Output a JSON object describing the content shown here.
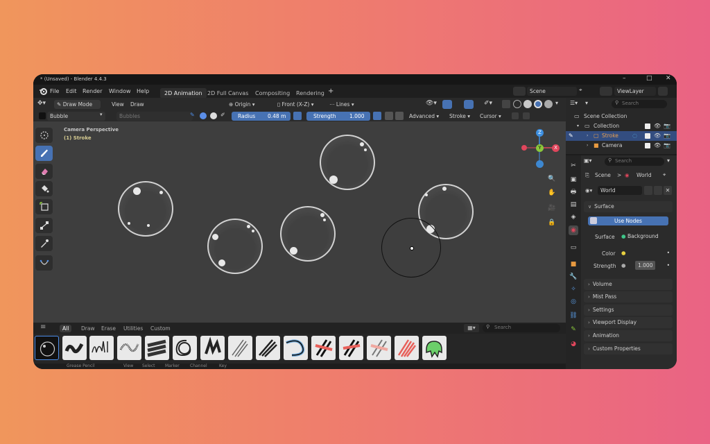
{
  "window": {
    "title": "* (Unsaved) - Blender 4.4.3",
    "minimize": "–",
    "maximize": "□",
    "close": "✕"
  },
  "menu": {
    "items": [
      "File",
      "Edit",
      "Render",
      "Window",
      "Help"
    ]
  },
  "workspaces": [
    "2D Animation",
    "2D Full Canvas",
    "Compositing",
    "Rendering"
  ],
  "workspace_add": "+",
  "scene": {
    "name": "Scene",
    "view_layer": "ViewLayer"
  },
  "header": {
    "mode": "Draw Mode",
    "view": "View",
    "draw": "Draw",
    "pivot": "Origin",
    "orientation": "Front (X-Z)",
    "stroke_placement": "Lines"
  },
  "tool_settings": {
    "brush": "Bubble",
    "material": "Bubbles",
    "radius_label": "Radius",
    "radius_value": "0.48 m",
    "strength_label": "Strength",
    "strength_value": "1.000",
    "advanced": "Advanced",
    "stroke": "Stroke",
    "cursor": "Cursor"
  },
  "viewport": {
    "camera_text": "Camera Perspective",
    "object_text": "(1) Stroke"
  },
  "gizmo": {
    "z": "Z",
    "x": "X",
    "y": "Y"
  },
  "asset_shelf": {
    "tabs": [
      "All",
      "Draw",
      "Erase",
      "Utilities",
      "Custom"
    ],
    "search_placeholder": "Search"
  },
  "statusbar": {
    "items": [
      "Grease Pencil",
      "View",
      "Select",
      "Marker",
      "Channel",
      "Key"
    ]
  },
  "outliner": {
    "search_placeholder": "Search",
    "scene_collection": "Scene Collection",
    "collection": "Collection",
    "stroke": "Stroke",
    "camera": "Camera"
  },
  "properties": {
    "search_placeholder": "Search",
    "breadcrumb_scene": "Scene",
    "breadcrumb_sep": ">",
    "breadcrumb_world": "World",
    "world_name": "World",
    "surface_panel": "Surface",
    "use_nodes": "Use Nodes",
    "surface_label": "Surface",
    "surface_value": "Background",
    "color_label": "Color",
    "strength_label": "Strength",
    "strength_value": "1.000",
    "panels": [
      "Volume",
      "Mist Pass",
      "Settings",
      "Viewport Display",
      "Animation",
      "Custom Properties"
    ]
  },
  "colors": {
    "accent": "#4772b3",
    "x_axis": "#e0465c",
    "y_axis": "#8bc83b",
    "z_axis": "#3d8fe0",
    "stroke_orange": "#e8a050",
    "camera_orange": "#e89a40"
  }
}
